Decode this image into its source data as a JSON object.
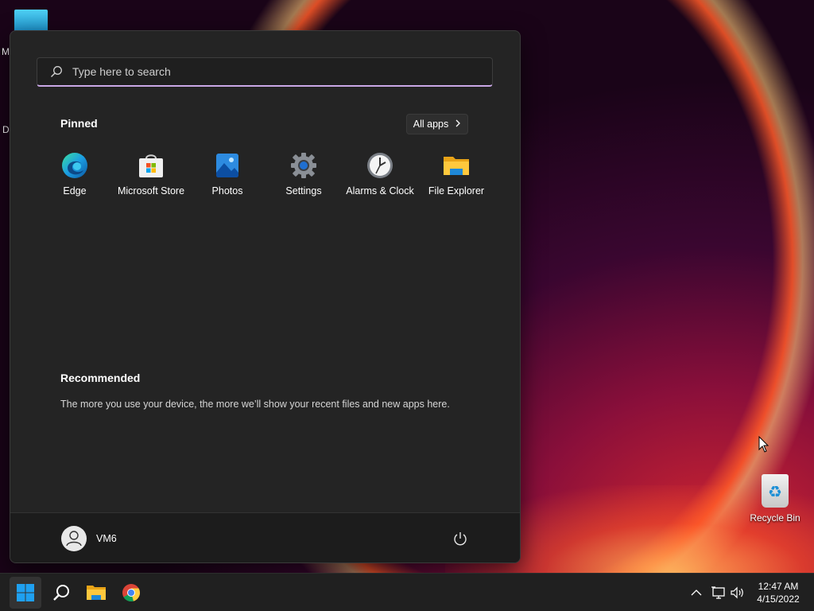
{
  "desktop": {
    "partial_labels": [
      "M",
      "Da"
    ],
    "recycle_bin_label": "Recycle Bin"
  },
  "start_menu": {
    "search": {
      "placeholder": "Type here to search",
      "value": ""
    },
    "pinned": {
      "title": "Pinned",
      "all_apps_label": "All apps",
      "apps": [
        {
          "label": "Edge",
          "icon": "edge-icon"
        },
        {
          "label": "Microsoft Store",
          "icon": "store-icon"
        },
        {
          "label": "Photos",
          "icon": "photos-icon"
        },
        {
          "label": "Settings",
          "icon": "gear-icon"
        },
        {
          "label": "Alarms & Clock",
          "icon": "clock-icon"
        },
        {
          "label": "File Explorer",
          "icon": "folder-icon"
        }
      ]
    },
    "recommended": {
      "title": "Recommended",
      "empty_text": "The more you use your device, the more we’ll show your recent files and new apps here."
    },
    "user": {
      "name": "VM6"
    }
  },
  "taskbar": {
    "apps": [
      "windows-start-icon",
      "search-icon",
      "folder-icon",
      "chrome-icon"
    ],
    "tray": [
      "chevron-up-icon",
      "network-icon",
      "volume-icon"
    ],
    "time": "12:47 AM",
    "date": "4/15/2022"
  },
  "colors": {
    "menu_bg": "#242424",
    "taskbar_bg": "#202020",
    "search_accent": "#c9a7e6",
    "windows_blue": "#1fa0f0"
  }
}
